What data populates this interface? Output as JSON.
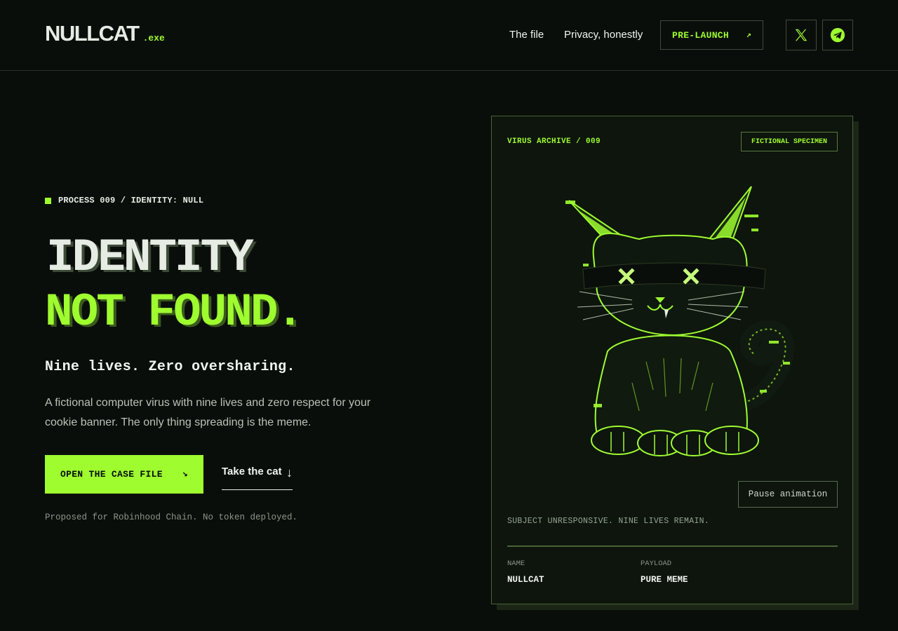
{
  "brand": {
    "name": "NULLCAT",
    "suffix": ".exe"
  },
  "nav": {
    "links": [
      "The file",
      "Privacy, honestly"
    ],
    "cta_label": "PRE-LAUNCH",
    "cta_arrow": "↗"
  },
  "social": {
    "icons": [
      "x-icon",
      "telegram-icon"
    ]
  },
  "hero": {
    "eyebrow": "PROCESS 009 / IDENTITY: NULL",
    "headline_line1": "IDENTITY",
    "headline_line2": "NOT FOUND.",
    "tagline": "Nine lives. Zero oversharing.",
    "description": "A fictional computer virus with nine lives and zero respect for your cookie banner. The only thing spreading is the meme.",
    "primary_cta": "OPEN THE CASE FILE",
    "primary_arrow": "↘",
    "secondary_cta": "Take the cat",
    "secondary_arrow": "↓",
    "footnote": "Proposed for Robinhood Chain. No token deployed."
  },
  "card": {
    "label": "VIRUS ARCHIVE / 009",
    "badge": "FICTIONAL SPECIMEN",
    "pause_label": "Pause animation",
    "status": "SUBJECT UNRESPONSIVE. NINE LIVES REMAIN.",
    "meta": [
      {
        "label": "NAME",
        "value": "NULLCAT"
      },
      {
        "label": "PAYLOAD",
        "value": "PURE MEME"
      }
    ]
  },
  "colors": {
    "accent": "#9efc2f",
    "background": "#0a0e0b",
    "card": "#0d150d",
    "text": "#e6ece3"
  }
}
